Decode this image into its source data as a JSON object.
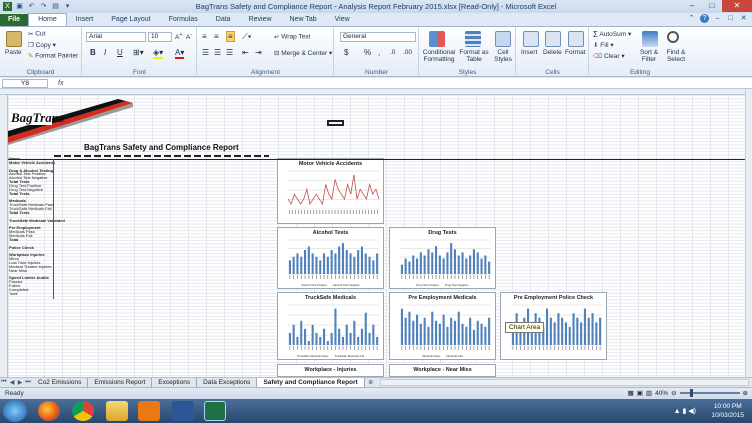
{
  "window": {
    "title": "BagTrans Safety and Compliance Report - Analysis Report February 2015.xlsx [Read-Only] - Microsoft Excel",
    "min_glyph": "–",
    "max_glyph": "□",
    "close_glyph": "✕"
  },
  "ribbon_tabs": [
    "File",
    "Home",
    "Insert",
    "Page Layout",
    "Formulas",
    "Data",
    "Review",
    "New Tab",
    "View"
  ],
  "ribbon": {
    "clipboard": {
      "label": "Clipboard",
      "paste": "Paste",
      "cut": "Cut",
      "copy": "Copy",
      "format_painter": "Format Painter"
    },
    "font": {
      "label": "Font",
      "name": "Arial",
      "size": "10",
      "bold": "B",
      "italic": "I",
      "underline": "U"
    },
    "alignment": {
      "label": "Alignment",
      "wrap_text": "Wrap Text",
      "merge_center": "Merge & Center"
    },
    "number": {
      "label": "Number",
      "format": "General",
      "currency": "$",
      "percent": "%",
      "comma": ","
    },
    "styles": {
      "label": "Styles",
      "conditional": "Conditional Formatting",
      "format_table": "Format as Table",
      "cell_styles": "Cell Styles"
    },
    "cells": {
      "label": "Cells",
      "insert": "Insert",
      "delete": "Delete",
      "format": "Format"
    },
    "editing": {
      "label": "Editing",
      "autosum": "AutoSum",
      "fill": "Fill",
      "clear": "Clear",
      "sort_filter": "Sort & Filter",
      "find_select": "Find & Select"
    }
  },
  "formula_bar": {
    "name_box": "Y8",
    "fx": "fx",
    "value": ""
  },
  "sheet": {
    "report_title": "BagTrans Safety and Compliance Report",
    "logo_text": "BagTrans",
    "row_labels": [
      {
        "t": "Name",
        "b": true
      },
      {
        "t": "Motor Vehicle Accidents",
        "b": true
      },
      {
        "t": "",
        "b": false
      },
      {
        "t": "Drug & Alcohol Testing",
        "b": true
      },
      {
        "t": "Alcohol Test Positive",
        "b": false
      },
      {
        "t": "Alcohol Test Negative",
        "b": false
      },
      {
        "t": "Total Tests",
        "b": true
      },
      {
        "t": "Drug Test Positive",
        "b": false
      },
      {
        "t": "Drug Test Negative",
        "b": false
      },
      {
        "t": "Total Tests",
        "b": true
      },
      {
        "t": "",
        "b": false
      },
      {
        "t": "Medicals",
        "b": true
      },
      {
        "t": "TruckSafe Medicals Pass",
        "b": false
      },
      {
        "t": "TruckSafe Medicals Fail",
        "b": false
      },
      {
        "t": "Total Tests",
        "b": true
      },
      {
        "t": "",
        "b": false
      },
      {
        "t": "TruckSafe Medicals Validated",
        "b": true
      },
      {
        "t": "",
        "b": false
      },
      {
        "t": "Pre Employment",
        "b": true
      },
      {
        "t": "Medicals Pass",
        "b": false
      },
      {
        "t": "Medicals Fail",
        "b": false
      },
      {
        "t": "Total",
        "b": true
      },
      {
        "t": "",
        "b": false
      },
      {
        "t": "Police Check",
        "b": true
      },
      {
        "t": "",
        "b": false
      },
      {
        "t": "Workplace Injuries",
        "b": true
      },
      {
        "t": "Minor",
        "b": false
      },
      {
        "t": "Lost Time Injuries",
        "b": false
      },
      {
        "t": "Medical Treated Injuries",
        "b": false
      },
      {
        "t": "Near Miss",
        "b": false
      },
      {
        "t": "",
        "b": false
      },
      {
        "t": "Speed Limiter Audits",
        "b": true
      },
      {
        "t": "Passed",
        "b": false
      },
      {
        "t": "Failed",
        "b": false
      },
      {
        "t": "Completed",
        "b": false
      },
      {
        "t": "Total",
        "b": false
      }
    ]
  },
  "charts": [
    {
      "id": "motor-vehicle-accidents",
      "title": "Motor Vehicle Accidents",
      "type": "line",
      "values": [
        2,
        1,
        3,
        2,
        1,
        2,
        4,
        1,
        2,
        3,
        2,
        1,
        5,
        3,
        2,
        6,
        4,
        3,
        2,
        5,
        3,
        7,
        2,
        4,
        3,
        2,
        5,
        3,
        4,
        2
      ]
    },
    {
      "id": "alcohol-tests",
      "title": "Alcohol Tests",
      "type": "bar",
      "values": [
        4,
        5,
        6,
        5,
        7,
        8,
        6,
        5,
        4,
        6,
        5,
        7,
        6,
        8,
        9,
        7,
        6,
        5,
        7,
        8,
        6,
        5,
        4,
        6
      ],
      "legend": [
        "Alcohol Test Positive",
        "Alcohol Test Negative"
      ]
    },
    {
      "id": "drug-tests",
      "title": "Drug Tests",
      "type": "bar",
      "values": [
        3,
        5,
        4,
        6,
        5,
        7,
        6,
        8,
        7,
        9,
        6,
        5,
        7,
        10,
        8,
        6,
        7,
        5,
        6,
        8,
        7,
        5,
        6,
        4
      ],
      "legend": [
        "Drug Test Positive",
        "Drug Test Negative"
      ]
    },
    {
      "id": "trucksafe-medicals",
      "title": "TruckSafe Medicals",
      "type": "bar",
      "values": [
        3,
        5,
        2,
        6,
        4,
        1,
        5,
        3,
        2,
        4,
        1,
        3,
        9,
        4,
        2,
        5,
        3,
        6,
        2,
        4,
        8,
        3,
        5,
        2
      ],
      "legend": [
        "TruckSafe Medicals Pass",
        "TruckSafe Medicals Fail"
      ]
    },
    {
      "id": "pre-employment-medicals",
      "title": "Pre Employment Medicals",
      "type": "bar",
      "values": [
        12,
        9,
        11,
        8,
        10,
        7,
        9,
        6,
        11,
        8,
        7,
        10,
        6,
        9,
        8,
        11,
        7,
        6,
        9,
        5,
        8,
        7,
        6,
        9
      ],
      "legend": [
        "Medicals Pass",
        "Medicals Fail"
      ]
    },
    {
      "id": "pre-employment-police-check",
      "title": "Pre Employment Police Check",
      "type": "bar",
      "values": [
        5,
        7,
        4,
        6,
        8,
        5,
        7,
        6,
        4,
        8,
        6,
        5,
        7,
        6,
        5,
        4,
        7,
        6,
        5,
        8,
        6,
        7,
        5,
        6
      ],
      "legend": []
    },
    {
      "id": "workplace-injuries",
      "title": "Workplace - Injuries",
      "type": "bar",
      "values": [],
      "legend": []
    },
    {
      "id": "workplace-near-miss",
      "title": "Workplace - Near Miss",
      "type": "bar",
      "values": [],
      "legend": []
    }
  ],
  "tooltip": "Chart Area",
  "sheet_tabs": [
    "Co2 Emissions",
    "Emissions Report",
    "Exceptions",
    "Data Exceptions",
    "Safety and Compliance Report"
  ],
  "active_sheet": "Safety and Compliance Report",
  "status": {
    "ready": "Ready",
    "zoom": "40%"
  },
  "clock": {
    "time": "10:00 PM",
    "date": "10/03/2015"
  }
}
